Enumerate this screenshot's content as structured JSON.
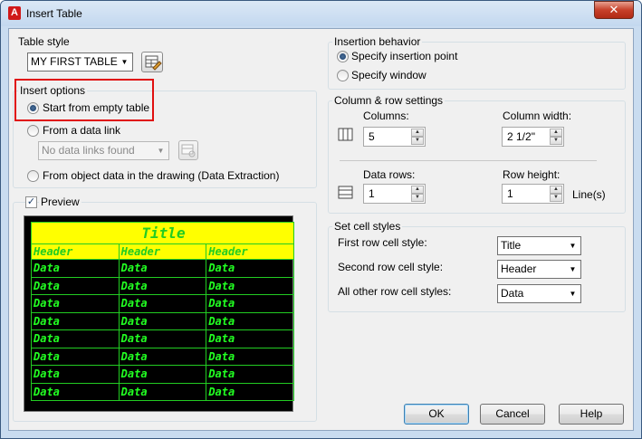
{
  "window": {
    "title": "Insert Table",
    "close_label": "✕"
  },
  "table_style": {
    "group_label": "Table style",
    "selected": "MY FIRST TABLE"
  },
  "insert_options": {
    "group_label": "Insert options",
    "empty_table": "Start from empty table",
    "data_link": "From a data link",
    "data_link_combo": "No data links found",
    "object_data": "From object data in the drawing (Data Extraction)"
  },
  "preview": {
    "label": "Preview",
    "checked": true,
    "title_cell": "Title",
    "header_cells": [
      "Header",
      "Header",
      "Header"
    ],
    "data_cell": "Data",
    "data_rows": 8
  },
  "insertion_behavior": {
    "group_label": "Insertion behavior",
    "specify_point": "Specify insertion point",
    "specify_window": "Specify window"
  },
  "col_row": {
    "group_label": "Column & row settings",
    "columns_label": "Columns:",
    "columns_value": "5",
    "column_width_label": "Column width:",
    "column_width_value": "2 1/2\"",
    "data_rows_label": "Data rows:",
    "data_rows_value": "1",
    "row_height_label": "Row height:",
    "row_height_value": "1",
    "lines_label": "Line(s)"
  },
  "cell_styles": {
    "group_label": "Set cell styles",
    "first_row_label": "First row cell style:",
    "first_row_value": "Title",
    "second_row_label": "Second row cell style:",
    "second_row_value": "Header",
    "other_rows_label": "All other row cell styles:",
    "other_rows_value": "Data"
  },
  "buttons": {
    "ok": "OK",
    "cancel": "Cancel",
    "help": "Help"
  },
  "colors": {
    "highlight": "#e01010",
    "preview_title_bg": "#ffff00",
    "preview_text": "#22ff22"
  }
}
